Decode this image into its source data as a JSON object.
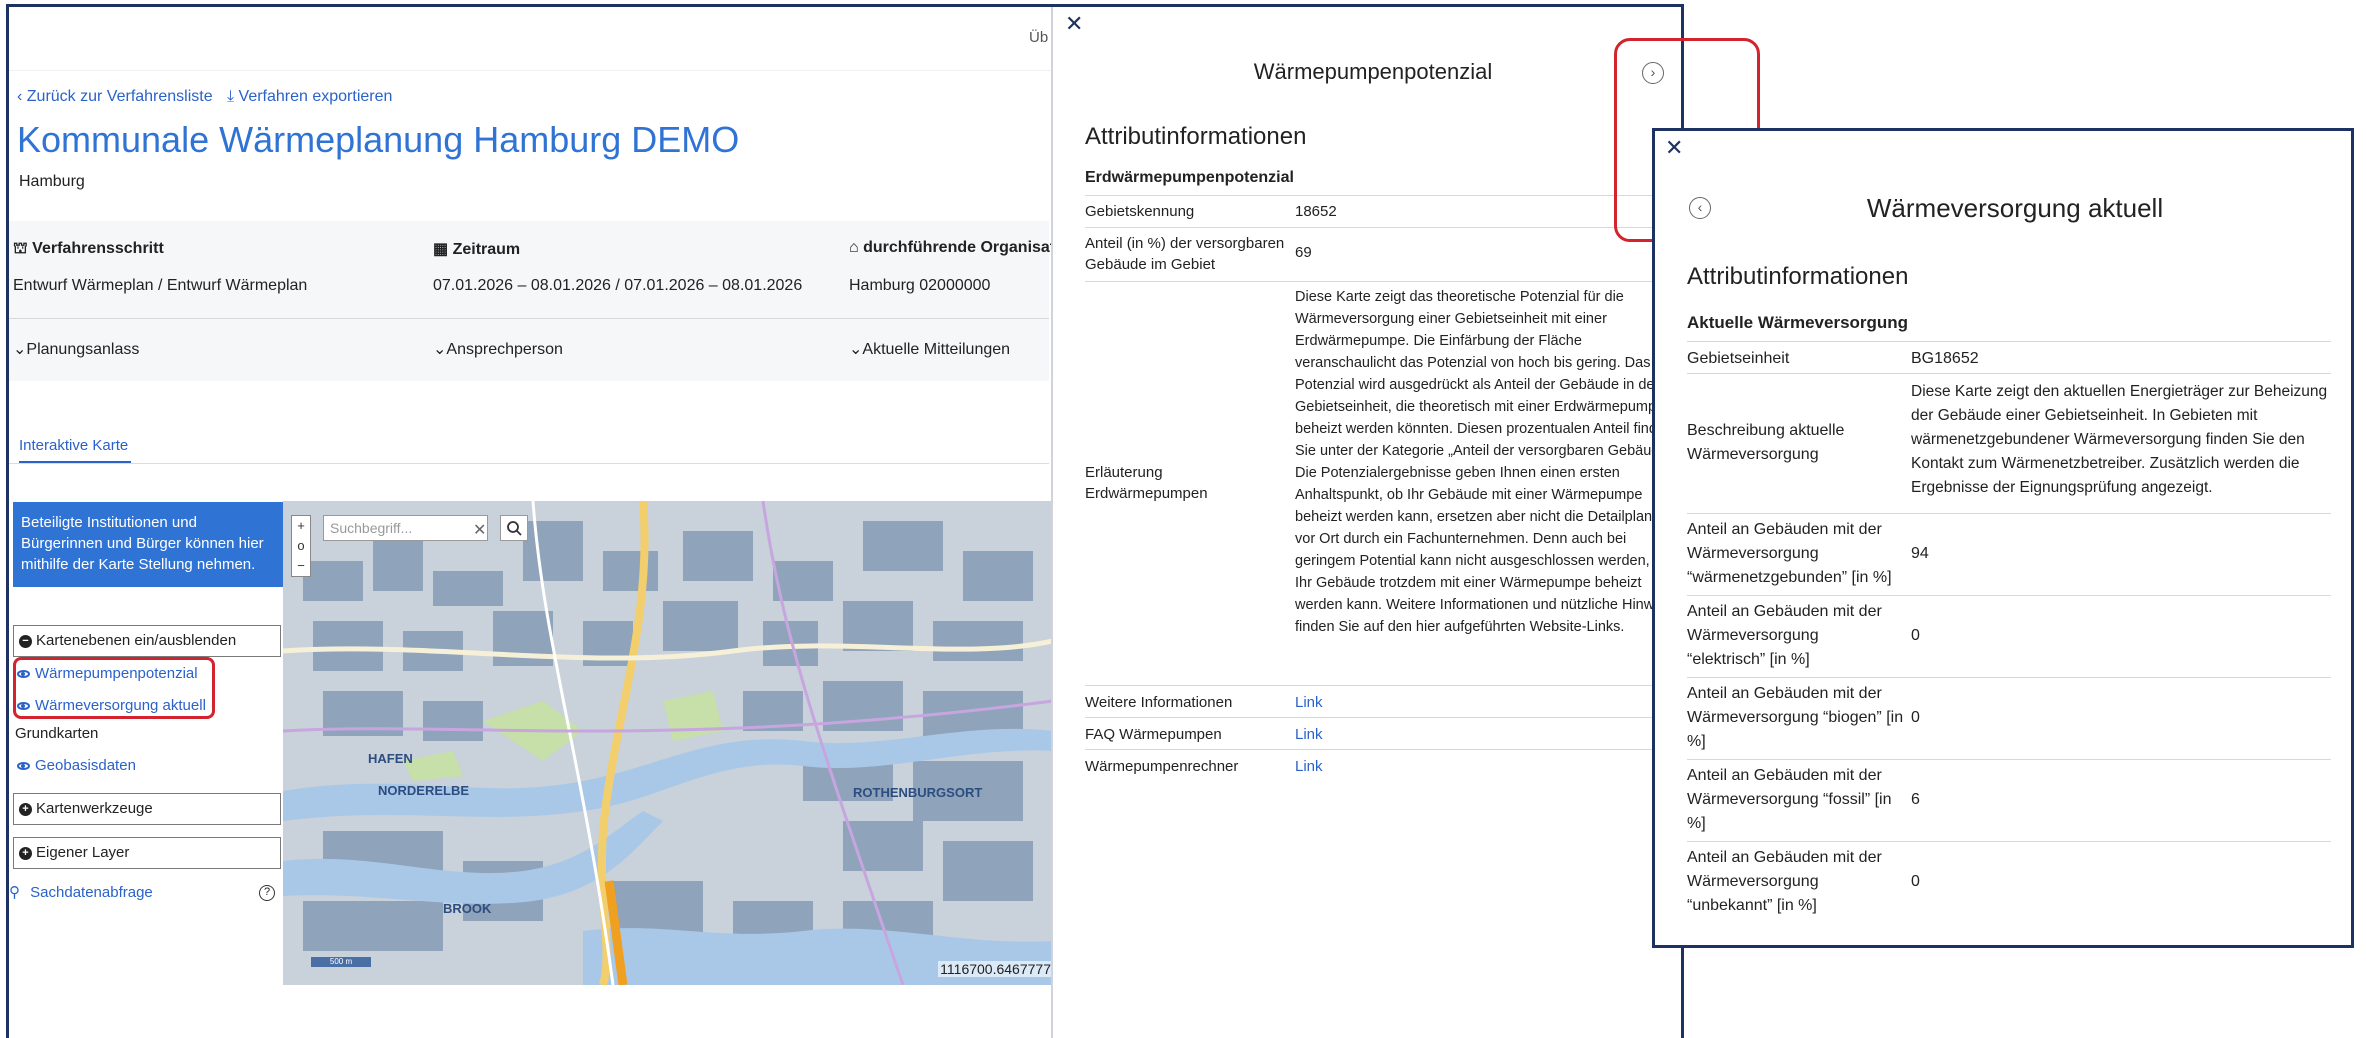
{
  "header": {
    "truncated_label": "Üb"
  },
  "breadcrumb": {
    "back": "Zurück zur Verfahrensliste",
    "export": "Verfahren exportieren"
  },
  "page": {
    "title": "Kommunale Wärmeplanung Hamburg DEMO",
    "subtitle": "Hamburg"
  },
  "info": {
    "step_head": "Verfahrensschritt",
    "step_value": "Entwurf Wärmeplan / Entwurf Wärmeplan",
    "period_head": "Zeitraum",
    "period_value": "07.01.2026 – 08.01.2026 / 07.01.2026 – 08.01.2026",
    "org_head": "durchführende Organisat",
    "org_value": "Hamburg 02000000",
    "accordion": [
      "Planungsanlass",
      "Ansprechperson",
      "Aktuelle Mitteilungen"
    ]
  },
  "tabs": {
    "interactive_map": "Interaktive Karte"
  },
  "sidebar": {
    "banner": "Beteiligte Institutionen und Bürgerinnen und Bürger können hier mithilfe der Karte Stellung nehmen.",
    "layers_toggle": "Kartenebenen ein/ausblenden",
    "layer_heat_pump": "Wärmepumpenpotenzial",
    "layer_supply": "Wärmeversorgung aktuell",
    "basemaps_head": "Grundkarten",
    "basemap_geo": "Geobasisdaten",
    "map_tools": "Kartenwerkzeuge",
    "own_layer": "Eigener Layer",
    "feature_query": "Sachdatenabfrage",
    "accent": "#2f73d4",
    "highlight": "#d3232f"
  },
  "map": {
    "search_placeholder": "Suchbegriff...",
    "coords": "1116700.6467777",
    "scale": "500 m",
    "labels": [
      "HAFEN",
      "NORDERELBE",
      "ROTHENBURGSORT",
      "BROOK"
    ],
    "zoom_in": "+",
    "zoom_home": "o",
    "zoom_out": "−"
  },
  "panel1": {
    "title": "Wärmepumpenpotenzial",
    "section": "Attributinformationen",
    "group": "Erdwärmepumpenpotenzial",
    "rows": [
      {
        "key": "Gebietskennung",
        "value": "18652"
      },
      {
        "key": "Anteil (in %) der versorgbaren Gebäude im Gebiet",
        "value": "69"
      },
      {
        "key": "Erläuterung Erdwärmepumpen",
        "value": "Diese Karte zeigt das theoretische Potenzial für die Wärmeversorgung einer Gebietseinheit mit einer Erdwärmepumpe. Die Einfärbung der Fläche veranschaulicht das Potenzial von hoch bis gering. Das Potenzial wird ausgedrückt als Anteil der Gebäude in der Gebietseinheit, die theoretisch mit einer Erdwärmepumpe beheizt werden könnten. Diesen prozentualen Anteil finden Sie unter der Kategorie „Anteil der versorgbaren Gebäude“. Die Potenzialergebnisse geben Ihnen einen ersten Anhaltspunkt, ob Ihr Gebäude mit einer Wärmepumpe beheizt werden kann, ersetzen aber nicht die Detailplanung vor Ort durch ein Fachunternehmen. Denn auch bei geringem Potential kann nicht ausgeschlossen werden, dass Ihr Gebäude trotzdem mit einer Wärmepumpe beheizt werden kann. Weitere Informationen und nützliche Hinweise finden Sie auf den hier aufgeführten Website-Links."
      },
      {
        "key": "Weitere Informationen",
        "value": "Link"
      },
      {
        "key": "FAQ Wärmepumpen",
        "value": "Link"
      },
      {
        "key": "Wärmepumpenrechner",
        "value": "Link"
      }
    ]
  },
  "panel2": {
    "title": "Wärmeversorgung aktuell",
    "section": "Attributinformationen",
    "group": "Aktuelle Wärmeversorgung",
    "rows": [
      {
        "key": "Gebietseinheit",
        "value": "BG18652"
      },
      {
        "key": "Beschreibung aktuelle Wärmeversorgung",
        "value": "Diese Karte zeigt den aktuellen Energieträger zur Beheizung der Gebäude einer Gebietseinheit. In Gebieten mit wärmenetzgebundener Wärmeversorgung finden Sie den Kontakt zum Wärmenetzbetreiber. Zusätzlich werden die Ergebnisse der Eignungsprüfung angezeigt."
      },
      {
        "key": "Anteil an Gebäuden mit der Wärmeversorgung “wärmenetzgebunden” [in %]",
        "value": "94"
      },
      {
        "key": "Anteil an Gebäuden mit der Wärmeversorgung “elektrisch” [in %]",
        "value": "0"
      },
      {
        "key": "Anteil an Gebäuden mit der Wärmeversorgung “biogen” [in %]",
        "value": "0"
      },
      {
        "key": "Anteil an Gebäuden mit der Wärmeversorgung “fossil” [in %]",
        "value": "6"
      },
      {
        "key": "Anteil an Gebäuden mit der Wärmeversorgung “unbekannt” [in %]",
        "value": "0"
      }
    ]
  }
}
